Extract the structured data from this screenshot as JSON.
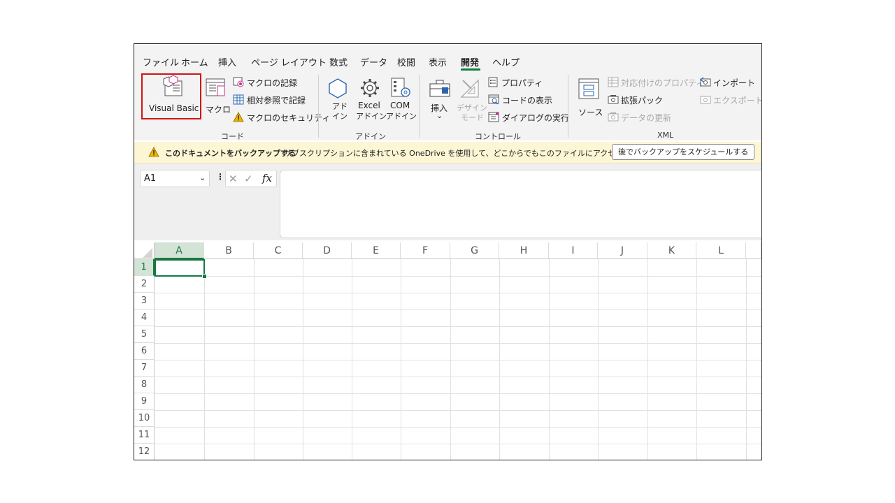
{
  "tabs": [
    "ファイル",
    "ホーム",
    "挿入",
    "ページ レイアウト",
    "数式",
    "データ",
    "校閲",
    "表示",
    "開発",
    "ヘルプ"
  ],
  "active_tab": "開発",
  "ribbon": {
    "code_group": {
      "label": "コード",
      "visual_basic": "Visual Basic",
      "macros": "マクロ",
      "record_macro": "マクロの記録",
      "relative_ref": "相対参照で記録",
      "macro_security": "マクロのセキュリティ"
    },
    "addins_group": {
      "label": "アドイン",
      "addins_line1": "アド",
      "addins_line2": "イン",
      "excel_addins_line1": "Excel",
      "excel_addins_line2": "アドイン",
      "com_addins_line1": "COM",
      "com_addins_line2": "アドイン"
    },
    "controls_group": {
      "label": "コントロール",
      "insert": "挿入",
      "insert_arrow": "⌄",
      "design_mode_line1": "デザイン",
      "design_mode_line2": "モード",
      "properties": "プロパティ",
      "view_code": "コードの表示",
      "run_dialog": "ダイアログの実行"
    },
    "xml_group": {
      "label": "XML",
      "source": "ソース",
      "map_properties": "対応付けのプロパティ",
      "expansion_packs": "拡張パック",
      "refresh_data": "データの更新",
      "import": "インポート",
      "export": "エクスポート"
    }
  },
  "notice": {
    "bold_text": "このドキュメントをバックアップする",
    "text": "サブスクリプションに含まれている OneDrive を使用して、どこからでもこのファイルにアクセスできます。",
    "button": "後でバックアップをスケジュールする"
  },
  "formula_bar": {
    "name_box": "A1",
    "cancel": "✕",
    "enter": "✓",
    "fx": "fx",
    "formula": ""
  },
  "columns": [
    "A",
    "B",
    "C",
    "D",
    "E",
    "F",
    "G",
    "H",
    "I",
    "J",
    "K",
    "L"
  ],
  "rows": [
    "1",
    "2",
    "3",
    "4",
    "5",
    "6",
    "7",
    "8",
    "9",
    "10",
    "11",
    "12"
  ],
  "selected_cell": "A1",
  "colors": {
    "accent": "#107c41",
    "highlight_box": "#d01515",
    "notice_bg": "#fcf6d4"
  }
}
